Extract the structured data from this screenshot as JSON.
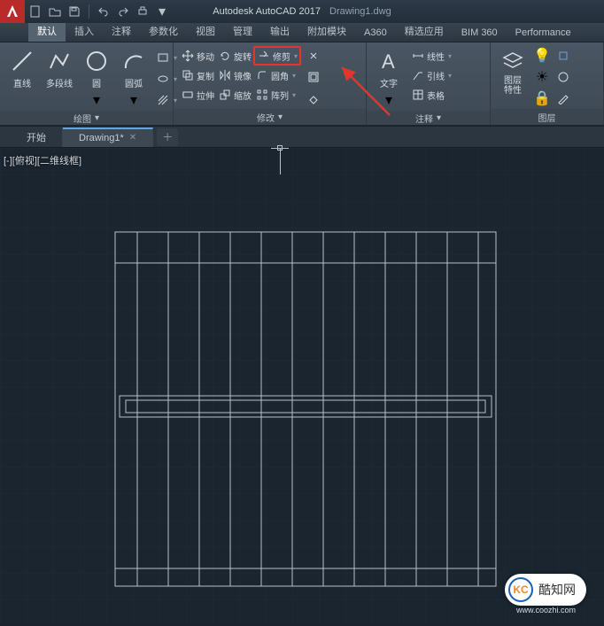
{
  "title": {
    "app": "Autodesk AutoCAD 2017",
    "doc": "Drawing1.dwg"
  },
  "tabs": [
    "默认",
    "插入",
    "注释",
    "参数化",
    "视图",
    "管理",
    "输出",
    "附加模块",
    "A360",
    "精选应用",
    "BIM 360",
    "Performance"
  ],
  "active_tab": "默认",
  "panels": {
    "draw": {
      "title": "绘图",
      "line": "直线",
      "polyline": "多段线",
      "circle": "圆",
      "arc": "圆弧"
    },
    "modify": {
      "title": "修改",
      "move": "移动",
      "copy": "复制",
      "stretch": "拉伸",
      "rotate": "旋转",
      "mirror": "镜像",
      "scale": "缩放",
      "trim": "修剪",
      "fillet": "圆角",
      "array": "阵列"
    },
    "annotate": {
      "title": "注释",
      "text": "文字",
      "linear": "线性",
      "leader": "引线",
      "table": "表格"
    },
    "layers": {
      "title": "图层",
      "props": "图层\n特性"
    }
  },
  "file_tabs": {
    "start": "开始",
    "active": "Drawing1*"
  },
  "viewport_label": "[-][俯视][二维线框]",
  "watermark": {
    "badge": "KC",
    "text": "酷知网",
    "url": "www.coozhi.com"
  },
  "highlight_target": "trim"
}
